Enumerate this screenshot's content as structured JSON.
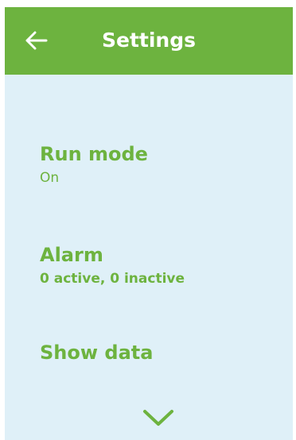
{
  "header": {
    "title": "Settings",
    "back_icon": "arrow-left-icon",
    "background": "#6db33f"
  },
  "menu": {
    "items": [
      {
        "label": "Run mode",
        "value": "On"
      },
      {
        "label": "Alarm",
        "value": "0 active, 0 inactive"
      },
      {
        "label": "Show data"
      }
    ]
  },
  "scroll": {
    "icon": "chevron-down-icon"
  },
  "colors": {
    "accent": "#6db33f",
    "background": "#dff0f8",
    "header_text": "#ffffff"
  }
}
